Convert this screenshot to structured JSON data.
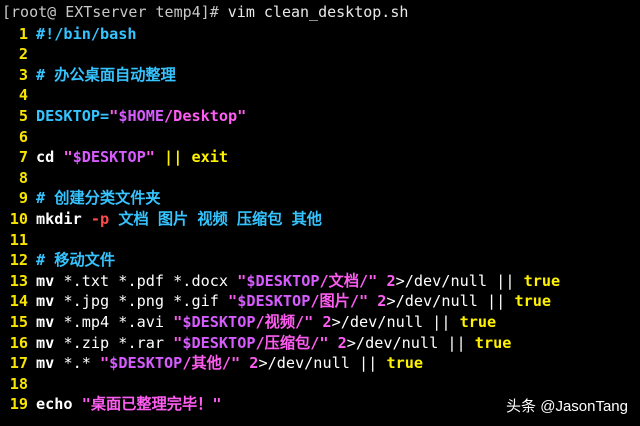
{
  "prompt": {
    "user_host": "[root@ EXTserver temp4]#",
    "command": " vim clean_desktop.sh"
  },
  "colors": {
    "background": "#000000",
    "line_number": "#f7e400",
    "comment": "#35c4ff",
    "string": "#ff5df2",
    "variable": "#d75cff",
    "flag": "#ff4b4b",
    "keyword": "#fff200"
  },
  "editor": {
    "lines": [
      {
        "num": "1",
        "tokens": [
          {
            "t": "#!/bin/bash",
            "c": "cc"
          }
        ]
      },
      {
        "num": "2",
        "tokens": []
      },
      {
        "num": "3",
        "tokens": [
          {
            "t": "# 办公桌面自动整理",
            "c": "cc"
          }
        ]
      },
      {
        "num": "4",
        "tokens": []
      },
      {
        "num": "5",
        "tokens": [
          {
            "t": "DESKTOP=",
            "c": "cc"
          },
          {
            "t": "\"",
            "c": "cs"
          },
          {
            "t": "$HOME",
            "c": "cv"
          },
          {
            "t": "/Desktop\"",
            "c": "cs"
          }
        ]
      },
      {
        "num": "6",
        "tokens": []
      },
      {
        "num": "7",
        "tokens": [
          {
            "t": "cd ",
            "c": "cw"
          },
          {
            "t": "\"",
            "c": "cs"
          },
          {
            "t": "$DESKTOP",
            "c": "cv"
          },
          {
            "t": "\"",
            "c": "cs"
          },
          {
            "t": " || exit",
            "c": "cy"
          }
        ]
      },
      {
        "num": "8",
        "tokens": []
      },
      {
        "num": "9",
        "tokens": [
          {
            "t": "# 创建分类文件夹",
            "c": "cc"
          }
        ]
      },
      {
        "num": "10",
        "tokens": [
          {
            "t": "mkdir ",
            "c": "cw"
          },
          {
            "t": "-p",
            "c": "cr"
          },
          {
            "t": " 文档 图片 视频 压缩包 其他",
            "c": "cc"
          }
        ]
      },
      {
        "num": "11",
        "tokens": []
      },
      {
        "num": "12",
        "tokens": [
          {
            "t": "# 移动文件",
            "c": "cc"
          }
        ]
      },
      {
        "num": "13",
        "tokens": [
          {
            "t": "mv ",
            "c": "cw"
          },
          {
            "t": "*.txt *.pdf *.docx ",
            "c": "cn"
          },
          {
            "t": "\"",
            "c": "cs"
          },
          {
            "t": "$DESKTOP",
            "c": "cv"
          },
          {
            "t": "/文档/\"",
            "c": "cs"
          },
          {
            "t": " 2",
            "c": "cs"
          },
          {
            "t": ">/dev/null || ",
            "c": "cn"
          },
          {
            "t": "true",
            "c": "cy"
          }
        ]
      },
      {
        "num": "14",
        "tokens": [
          {
            "t": "mv ",
            "c": "cw"
          },
          {
            "t": "*.jpg *.png *.gif ",
            "c": "cn"
          },
          {
            "t": "\"",
            "c": "cs"
          },
          {
            "t": "$DESKTOP",
            "c": "cv"
          },
          {
            "t": "/图片/\"",
            "c": "cs"
          },
          {
            "t": " 2",
            "c": "cs"
          },
          {
            "t": ">/dev/null || ",
            "c": "cn"
          },
          {
            "t": "true",
            "c": "cy"
          }
        ]
      },
      {
        "num": "15",
        "tokens": [
          {
            "t": "mv ",
            "c": "cw"
          },
          {
            "t": "*.mp4 *.avi ",
            "c": "cn"
          },
          {
            "t": "\"",
            "c": "cs"
          },
          {
            "t": "$DESKTOP",
            "c": "cv"
          },
          {
            "t": "/视频/\"",
            "c": "cs"
          },
          {
            "t": " 2",
            "c": "cs"
          },
          {
            "t": ">/dev/null || ",
            "c": "cn"
          },
          {
            "t": "true",
            "c": "cy"
          }
        ]
      },
      {
        "num": "16",
        "tokens": [
          {
            "t": "mv ",
            "c": "cw"
          },
          {
            "t": "*.zip *.rar ",
            "c": "cn"
          },
          {
            "t": "\"",
            "c": "cs"
          },
          {
            "t": "$DESKTOP",
            "c": "cv"
          },
          {
            "t": "/压缩包/\"",
            "c": "cs"
          },
          {
            "t": " 2",
            "c": "cs"
          },
          {
            "t": ">/dev/null || ",
            "c": "cn"
          },
          {
            "t": "true",
            "c": "cy"
          }
        ]
      },
      {
        "num": "17",
        "tokens": [
          {
            "t": "mv ",
            "c": "cw"
          },
          {
            "t": "*.* ",
            "c": "cn"
          },
          {
            "t": "\"",
            "c": "cs"
          },
          {
            "t": "$DESKTOP",
            "c": "cv"
          },
          {
            "t": "/其他/\"",
            "c": "cs"
          },
          {
            "t": " 2",
            "c": "cs"
          },
          {
            "t": ">/dev/null || ",
            "c": "cn"
          },
          {
            "t": "true",
            "c": "cy"
          }
        ]
      },
      {
        "num": "18",
        "tokens": []
      },
      {
        "num": "19",
        "tokens": [
          {
            "t": "echo ",
            "c": "cw"
          },
          {
            "t": "\"桌面已整理完毕！\"",
            "c": "cs"
          }
        ]
      }
    ]
  },
  "watermark": {
    "text": "头条 @JasonTang"
  }
}
